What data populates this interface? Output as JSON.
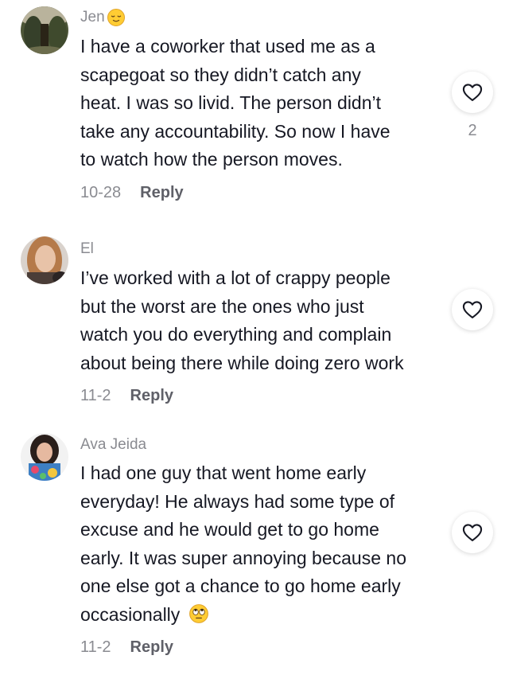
{
  "comments": [
    {
      "username": "Jen",
      "username_emoji": "relieved-face",
      "lines": [
        "I have a coworker that used me as a",
        "scapegoat so they didn’t catch any",
        "heat. I was so livid. The person didn’t",
        "take any accountability. So now I have",
        "to watch how the person moves."
      ],
      "date": "10-28",
      "reply_label": "Reply",
      "like_icon": "heart-outline",
      "like_count": "2"
    },
    {
      "username": "El",
      "lines": [
        "I’ve worked with a lot of crappy people",
        "but the worst are the ones who just",
        "watch you do everything and complain",
        "about being there while doing zero work"
      ],
      "date": "11-2",
      "reply_label": "Reply",
      "like_icon": "heart-outline"
    },
    {
      "username": "Ava Jeida",
      "lines": [
        "I had one guy that went home early",
        "everyday! He always had some type of",
        "excuse and he would get to go home",
        "early. It was super annoying because no",
        "one else got a chance to go home early",
        "occasionally"
      ],
      "text_emoji": "eye-roll-face",
      "date": "11-2",
      "reply_label": "Reply",
      "like_icon": "heart-outline"
    }
  ]
}
